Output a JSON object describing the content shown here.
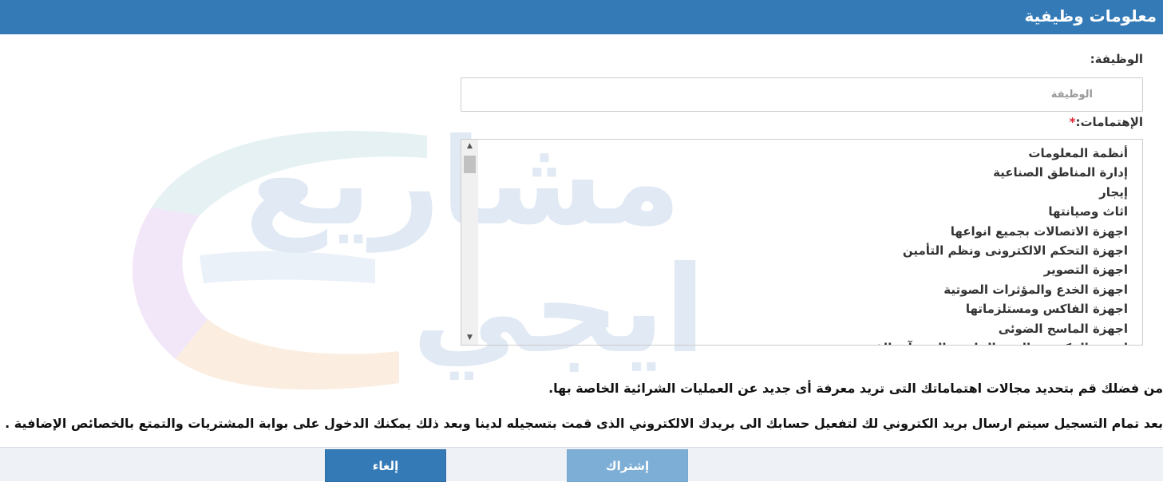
{
  "header": {
    "title": "معلومات وظيفية"
  },
  "form": {
    "job_label": "الوظيفة:",
    "job_placeholder": "الوظيفة",
    "job_value": "",
    "interests_label": "الإهتمامات:",
    "required_mark": "*",
    "interests_options": [
      "أنظمة المعلومات",
      "إدارة المناطق الصناعية",
      "إيجار",
      "اثاث وصيانتها",
      "اجهزة الاتصالات بجميع انواعها",
      "اجهزة التحكم الالكترونى ونظم التأمين",
      "اجهزة التصوير",
      "اجهزة الخدع والمؤثرات الصوتية",
      "اجهزة الفاكس ومستلزماتها",
      "اجهزة الماسح الضوئى",
      "اجهزة الحكومة والبنية الخاصة بالمنشآت الفنية"
    ]
  },
  "notes": {
    "interests_hint": "من فضلك قم بتحديد مجالات اهتماماتك التى تريد معرفة أى جديد عن العمليات الشرائية الخاصة بها.",
    "registration_hint": "بعد تمام التسجيل سيتم ارسال بريد الكتروني لك لتفعيل حسابك الى بريدك الالكتروني الذى قمت بتسجيله لدينا وبعد ذلك يمكنك الدخول على بوابة المشتريات والتمتع بالخصائص الإضافية ."
  },
  "footer": {
    "subscribe_label": "إشتراك",
    "cancel_label": "إلغاء"
  },
  "watermark": {
    "text_line1": "مشاريع",
    "text_line2": "ايجي"
  },
  "colors": {
    "primary": "#337ab7",
    "button_disabled": "#7daed6",
    "required": "#d9232d"
  },
  "icons": {
    "scroll_up": "triangle-up-icon",
    "scroll_down": "triangle-down-icon"
  }
}
